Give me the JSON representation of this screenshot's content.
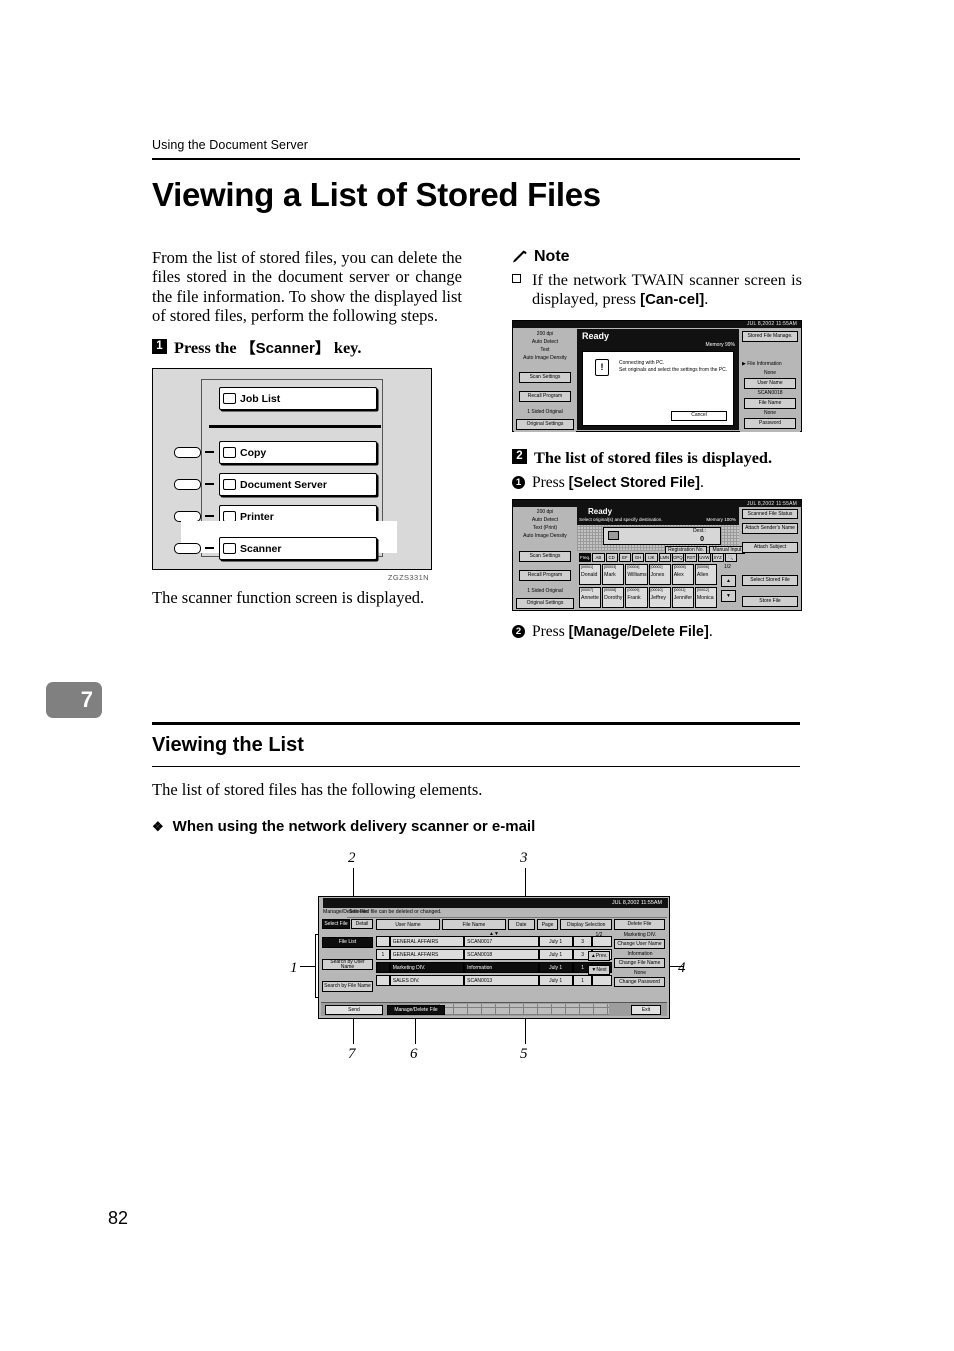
{
  "header": {
    "running_head": "Using the Document Server",
    "page_number": "82",
    "chapter_tab": "7"
  },
  "title": "Viewing a List of Stored Files",
  "intro": "From the list of stored files, you can delete the files stored in the document server or change the file information. To show the displayed list of stored files, perform the following steps.",
  "step1": {
    "num": "1",
    "text_a": "Press the ",
    "key": "【Scanner】",
    "text_b": " key."
  },
  "step1_caption": "The scanner function screen is displayed.",
  "panel_figure": {
    "code": "ZGZS331N",
    "keys": [
      "Job List",
      "Copy",
      "Document Server",
      "Printer",
      "Scanner"
    ]
  },
  "note": {
    "heading": "Note",
    "item_a": "If the network TWAIN scanner screen is displayed, press ",
    "item_bold": "[Can-cel]",
    "item_b": "."
  },
  "twain_screen": {
    "datetime": "JUL   8,2002 11:55AM",
    "status": "Ready",
    "memory": "Memory 99%",
    "settings": [
      "200 dpi",
      "Auto Detect",
      "Text",
      "Auto Image Density"
    ],
    "left_buttons": [
      "Scan Settings",
      "Recall Program"
    ],
    "left_labels": [
      "1 Sided Original"
    ],
    "original_settings": "Original Settings",
    "dialog_icon": "!",
    "dialog_line1": "Connecting with PC.",
    "dialog_line2": "Set originals and select the settings from the PC.",
    "cancel": "Cancel",
    "right_top": "Stored File Manage.",
    "right_section": "File Information",
    "right_items": [
      {
        "value": "None",
        "button": "User Name"
      },
      {
        "value": "SCAN0018",
        "button": "File Name"
      },
      {
        "value": "None",
        "button": "Password"
      }
    ]
  },
  "step2": {
    "num": "2",
    "text": "The list of stored files is displayed.",
    "sub1_num": "1",
    "sub1_a": "Press ",
    "sub1_bold": "[Select Stored File]",
    "sub1_b": ".",
    "sub2_num": "2",
    "sub2_a": "Press ",
    "sub2_bold": "[Manage/Delete File]",
    "sub2_b": "."
  },
  "dest_screen": {
    "datetime": "JUL   8,2002 11:55AM",
    "status": "Ready",
    "subtext": "Select original(s) and specify destination.",
    "memory": "Memory 100%",
    "settings": [
      "200 dpi",
      "Auto Detect",
      "Text (Print)",
      "Auto Image Density"
    ],
    "left_buttons": [
      "Scan Settings",
      "Recall Program"
    ],
    "left_labels": [
      "1 Sided Original"
    ],
    "original_settings": "Original Settings",
    "dest_label": "Dest.:",
    "dest_count": "0",
    "reg_no": "Registration No.",
    "manual_input": "Manual Input",
    "tabs": [
      "Freq.",
      "AB",
      "CD",
      "EF",
      "GH",
      "IJK",
      "LMN",
      "OPQ",
      "RST",
      "UVW",
      "XYZ"
    ],
    "names_row1": [
      {
        "id": "[00001]",
        "name": "Donald"
      },
      {
        "id": "[00003]",
        "name": "Mark"
      },
      {
        "id": "[00004]",
        "name": "Williams"
      },
      {
        "id": "[00002]",
        "name": "Jones"
      },
      {
        "id": "[00005]",
        "name": "Alex"
      },
      {
        "id": "[00006]",
        "name": "Allen"
      }
    ],
    "names_row2": [
      {
        "id": "[00007]",
        "name": "Annette"
      },
      {
        "id": "[00008]",
        "name": "Dorothy"
      },
      {
        "id": "[00009]",
        "name": "Frank"
      },
      {
        "id": "[00010]",
        "name": "Jeffrey"
      },
      {
        "id": "[00011]",
        "name": "Jennifer"
      },
      {
        "id": "[00012]",
        "name": "Monica"
      }
    ],
    "page_indicator": "1/2",
    "scroll_up": "▲",
    "scroll_down": "▼",
    "right_top": "Scanned File Status",
    "right_buttons": [
      "Attach Sender's Name",
      "Attach Subject",
      "Select Stored File",
      "Store File"
    ]
  },
  "section": {
    "heading": "Viewing the List",
    "para": "The list of stored files has the following elements.",
    "bullet": "When using the network delivery scanner or e-mail"
  },
  "mgmt_screen": {
    "datetime": "JUL   8,2002 11:55AM",
    "screen_name": "Manage/Delete File",
    "subhead": "Selected file can be deleted or changed.",
    "tab_select": "Select File",
    "tab_detail": "Detail",
    "left_buttons": [
      "File List",
      "Search by User Name",
      "Search by File Name"
    ],
    "columns": [
      "User Name",
      "File Name",
      "Date",
      "Page",
      "Display Selection"
    ],
    "rows": [
      {
        "mark": "",
        "user": "GENERAL AFFAIRS",
        "file": "SCAN0017",
        "date": "July  1",
        "page": "3",
        "sel": "",
        "selected": false
      },
      {
        "mark": "1",
        "user": "GENERAL AFFAIRS",
        "file": "SCAN0018",
        "date": "July  1",
        "page": "3",
        "sel": "",
        "selected": false
      },
      {
        "mark": "",
        "user": "Marketing DIV.",
        "file": "Information",
        "date": "July  1",
        "page": "1",
        "sel": "1",
        "selected": true
      },
      {
        "mark": "",
        "user": "SALES DIV.",
        "file": "SCAN0013",
        "date": "July  1",
        "page": "1",
        "sel": "",
        "selected": false
      }
    ],
    "page_indicator": "1/2",
    "prev": "Prev.",
    "next": "Next",
    "right_delete": "Delete File",
    "right_pairs": [
      {
        "value": "Marketing DIV.",
        "button": "Change User Name"
      },
      {
        "value": "Information",
        "button": "Change File Name"
      },
      {
        "value": "None",
        "button": "Change Password"
      }
    ],
    "bottom_send": "Send",
    "bottom_manage": "Manage/Delete File",
    "bottom_exit": "Exit",
    "callouts": [
      "1",
      "2",
      "3",
      "4",
      "5",
      "6",
      "7"
    ]
  }
}
